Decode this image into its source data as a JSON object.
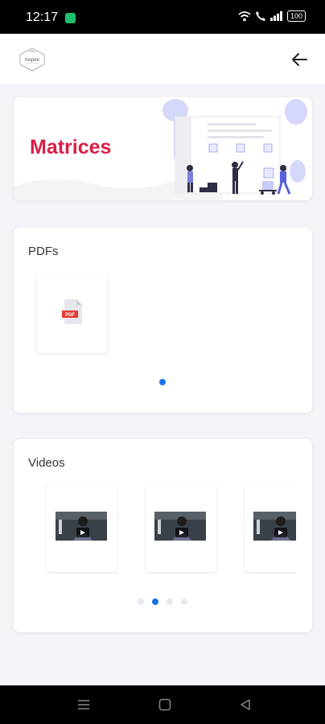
{
  "status_bar": {
    "time": "12:17",
    "battery": "100"
  },
  "header": {
    "logo_text": "Inspire"
  },
  "banner": {
    "title": "Matrices"
  },
  "pdfs": {
    "title": "PDFs",
    "items": [
      {
        "badge": "PDF"
      }
    ],
    "page_count": 1,
    "active_page": 0
  },
  "videos": {
    "title": "Videos",
    "items": [
      {},
      {},
      {}
    ],
    "page_count": 4,
    "active_page": 1
  },
  "colors": {
    "accent": "#1a73e8",
    "title": "#d81e45",
    "pdf_red": "#e53935"
  }
}
